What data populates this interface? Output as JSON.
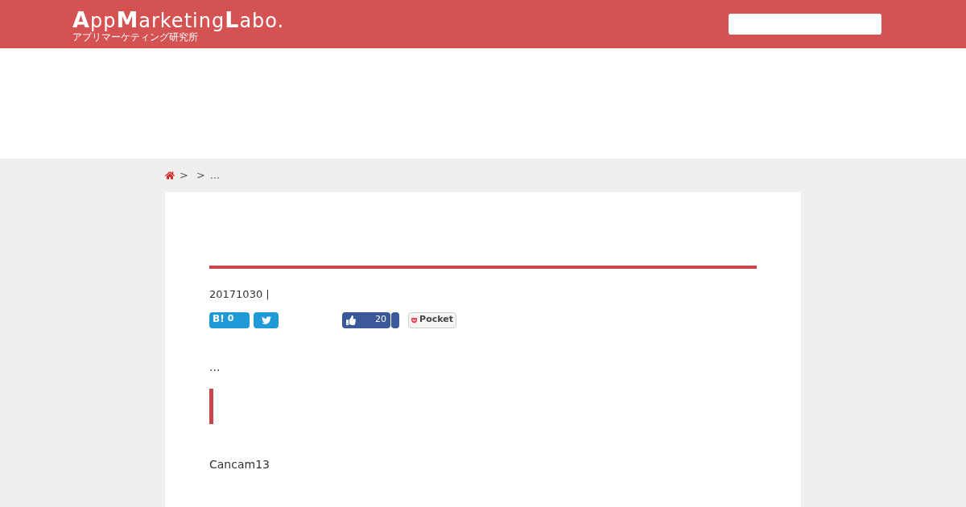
{
  "header": {
    "logo": {
      "segments": [
        {
          "text": "A",
          "kind": "cap"
        },
        {
          "text": "pp",
          "kind": "plain"
        },
        {
          "text": "M",
          "kind": "cap"
        },
        {
          "text": "arketing",
          "kind": "plain"
        },
        {
          "text": "L",
          "kind": "cap"
        },
        {
          "text": "abo.",
          "kind": "plain"
        }
      ],
      "subtitle": "アプリマーケティング研究所"
    }
  },
  "breadcrumb": {
    "separators": [
      ">",
      ">"
    ],
    "current": "..."
  },
  "article": {
    "meta": "20171030 |",
    "share": [
      {
        "kind": "hatena",
        "label": "B!",
        "count": "0"
      },
      {
        "kind": "twitter"
      },
      {
        "kind": "facebook",
        "count": "20"
      },
      {
        "kind": "facebook-extra"
      },
      {
        "kind": "pocket",
        "label": "Pocket"
      }
    ],
    "excerpt": "...",
    "body": "Cancam13"
  }
}
